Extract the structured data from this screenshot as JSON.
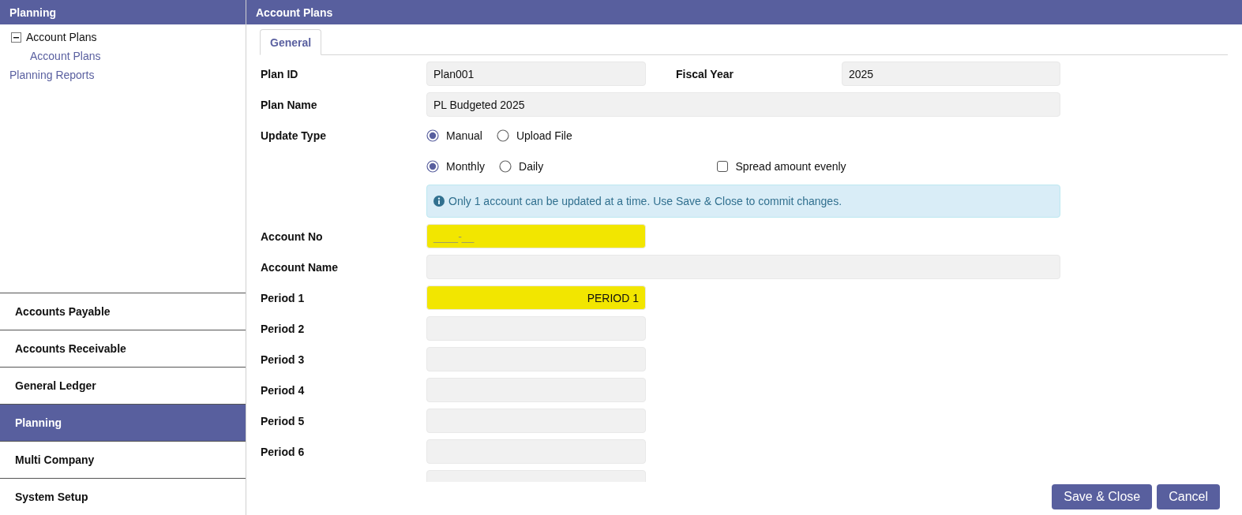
{
  "sidebar": {
    "title": "Planning",
    "tree": [
      {
        "label": "Account Plans",
        "expanded": true,
        "children": [
          {
            "label": "Account Plans"
          }
        ]
      },
      {
        "label": "Planning Reports"
      }
    ],
    "modules": [
      {
        "label": "Accounts Payable",
        "selected": false
      },
      {
        "label": "Accounts Receivable",
        "selected": false
      },
      {
        "label": "General Ledger",
        "selected": false
      },
      {
        "label": "Planning",
        "selected": true
      },
      {
        "label": "Multi Company",
        "selected": false
      },
      {
        "label": "System Setup",
        "selected": false
      }
    ]
  },
  "main": {
    "title": "Account Plans",
    "tabs": [
      {
        "label": "General",
        "selected": true
      }
    ],
    "rows": [
      {
        "kind": "pair",
        "label": "Plan ID",
        "value": "Plan001",
        "label2": "Fiscal Year",
        "value2": "2025"
      },
      {
        "kind": "wide",
        "label": "Plan Name",
        "value": "PL Budgeted 2025"
      },
      {
        "kind": "radios",
        "label": "Update Type",
        "options": [
          {
            "label": "Manual",
            "selected": true
          },
          {
            "label": "Upload File",
            "selected": false
          }
        ]
      },
      {
        "kind": "radios",
        "options": [
          {
            "label": "Monthly",
            "selected": true
          },
          {
            "label": "Daily",
            "selected": false
          }
        ],
        "checkbox": {
          "label": "Spread amount evenly",
          "checked": false
        }
      },
      {
        "kind": "info",
        "text": "Only 1 account can be updated at a time. Use Save & Close to commit changes."
      },
      {
        "kind": "text",
        "label": "Account No",
        "placeholder": "____-__",
        "highlighted": true
      },
      {
        "kind": "wide",
        "label": "Account Name"
      },
      {
        "kind": "amount",
        "label": "Period 1",
        "value": "PERIOD 1",
        "highlighted": true
      },
      {
        "kind": "amount",
        "label": "Period 2"
      },
      {
        "kind": "amount",
        "label": "Period 3"
      },
      {
        "kind": "amount",
        "label": "Period 4"
      },
      {
        "kind": "amount",
        "label": "Period 5"
      },
      {
        "kind": "amount",
        "label": "Period 6"
      },
      {
        "kind": "amount"
      }
    ],
    "buttons": [
      "Save & Close",
      "Cancel"
    ]
  }
}
